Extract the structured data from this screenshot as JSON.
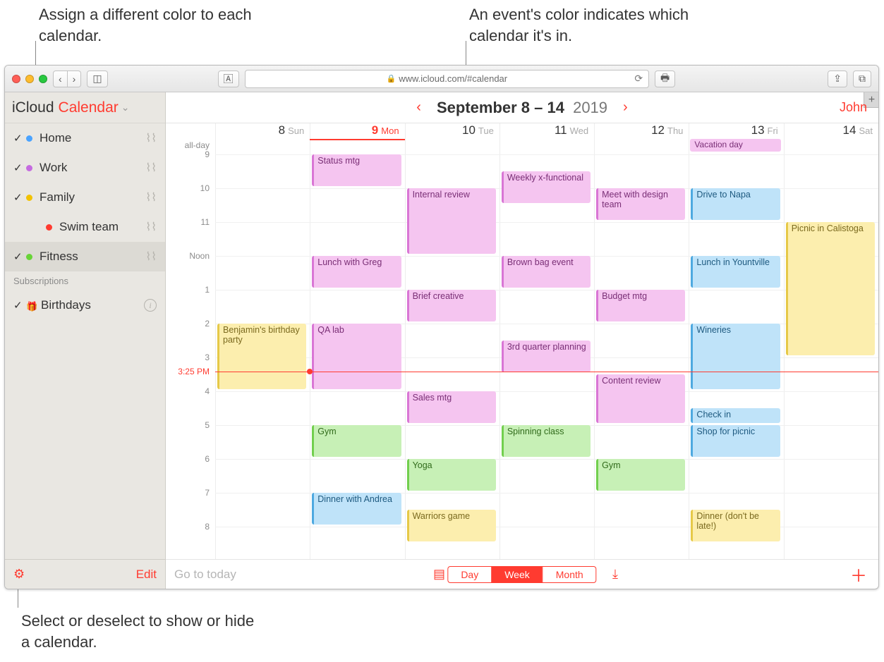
{
  "callouts": {
    "top_left": "Assign a different color to each calendar.",
    "top_right": "An event's color indicates which calendar it's in.",
    "bottom": "Select or deselect to show or hide a calendar."
  },
  "browser": {
    "url": "www.icloud.com/#calendar"
  },
  "sidebar": {
    "app_prefix": "iCloud",
    "app_name": "Calendar",
    "section_subs": "Subscriptions",
    "edit": "Edit",
    "calendars": [
      {
        "name": "Home",
        "color": "#4aa3ff",
        "checked": true,
        "shared": true,
        "indent": false,
        "selected": false
      },
      {
        "name": "Work",
        "color": "#c56be0",
        "checked": true,
        "shared": true,
        "indent": false,
        "selected": false
      },
      {
        "name": "Family",
        "color": "#f2c200",
        "checked": true,
        "shared": true,
        "indent": false,
        "selected": false
      },
      {
        "name": "Swim team",
        "color": "#ff3b30",
        "checked": false,
        "shared": true,
        "indent": true,
        "selected": false
      },
      {
        "name": "Fitness",
        "color": "#68d437",
        "checked": true,
        "shared": true,
        "indent": false,
        "selected": true
      }
    ],
    "subs": [
      {
        "name": "Birthdays",
        "checked": true
      }
    ]
  },
  "header": {
    "range": "September 8 – 14",
    "year": "2019",
    "user": "John"
  },
  "days": [
    {
      "num": "8",
      "name": "Sun",
      "today": false
    },
    {
      "num": "9",
      "name": "Mon",
      "today": true
    },
    {
      "num": "10",
      "name": "Tue",
      "today": false
    },
    {
      "num": "11",
      "name": "Wed",
      "today": false
    },
    {
      "num": "12",
      "name": "Thu",
      "today": false
    },
    {
      "num": "13",
      "name": "Fri",
      "today": false
    },
    {
      "num": "14",
      "name": "Sat",
      "today": false
    }
  ],
  "time": {
    "allday": "all-day",
    "labels": [
      "9",
      "10",
      "11",
      "Noon",
      "1",
      "2",
      "3",
      "4",
      "5",
      "6",
      "7",
      "8"
    ],
    "now": "3:25 PM"
  },
  "allday_events": [
    {
      "day": 5,
      "span": 1,
      "title": "Vacation day",
      "cls": "ev-purple"
    }
  ],
  "events": [
    {
      "day": 0,
      "start": 2.0,
      "dur": 2.0,
      "title": "Benjamin's birthday party",
      "cls": "ev-yellow"
    },
    {
      "day": 1,
      "start": 9.0,
      "dur": 1.0,
      "title": "Status mtg",
      "cls": "ev-purple"
    },
    {
      "day": 1,
      "start": 12.0,
      "dur": 1.0,
      "title": "Lunch with Greg",
      "cls": "ev-purple"
    },
    {
      "day": 1,
      "start": 2.0,
      "dur": 2.0,
      "title": "QA lab",
      "cls": "ev-purple"
    },
    {
      "day": 1,
      "start": 5.0,
      "dur": 1.0,
      "title": "Gym",
      "cls": "ev-green"
    },
    {
      "day": 1,
      "start": 7.0,
      "dur": 1.0,
      "title": "Dinner with Andrea",
      "cls": "ev-blue"
    },
    {
      "day": 2,
      "start": 10.0,
      "dur": 2.0,
      "title": "Internal review",
      "cls": "ev-purple"
    },
    {
      "day": 2,
      "start": 1.0,
      "dur": 1.0,
      "title": "Brief creative",
      "cls": "ev-purple"
    },
    {
      "day": 2,
      "start": 4.0,
      "dur": 1.0,
      "title": "Sales mtg",
      "cls": "ev-purple"
    },
    {
      "day": 2,
      "start": 6.0,
      "dur": 1.0,
      "title": "Yoga",
      "cls": "ev-green"
    },
    {
      "day": 2,
      "start": 7.5,
      "dur": 1.0,
      "title": "Warriors game",
      "cls": "ev-yellow"
    },
    {
      "day": 3,
      "start": 9.5,
      "dur": 1.0,
      "title": "Weekly x-functional",
      "cls": "ev-purple"
    },
    {
      "day": 3,
      "start": 12.0,
      "dur": 1.0,
      "title": "Brown bag event",
      "cls": "ev-purple"
    },
    {
      "day": 3,
      "start": 2.5,
      "dur": 1.0,
      "title": "3rd quarter planning",
      "cls": "ev-purple"
    },
    {
      "day": 3,
      "start": 5.0,
      "dur": 1.0,
      "title": "Spinning class",
      "cls": "ev-green"
    },
    {
      "day": 4,
      "start": 10.0,
      "dur": 1.0,
      "title": "Meet with design team",
      "cls": "ev-purple"
    },
    {
      "day": 4,
      "start": 1.0,
      "dur": 1.0,
      "title": "Budget mtg",
      "cls": "ev-purple"
    },
    {
      "day": 4,
      "start": 3.5,
      "dur": 1.5,
      "title": "Content review",
      "cls": "ev-purple"
    },
    {
      "day": 4,
      "start": 6.0,
      "dur": 1.0,
      "title": "Gym",
      "cls": "ev-green"
    },
    {
      "day": 5,
      "start": 10.0,
      "dur": 1.0,
      "title": "Drive to Napa",
      "cls": "ev-blue"
    },
    {
      "day": 5,
      "start": 12.0,
      "dur": 1.0,
      "title": "Lunch in Yountville",
      "cls": "ev-blue"
    },
    {
      "day": 5,
      "start": 2.0,
      "dur": 2.0,
      "title": "Wineries",
      "cls": "ev-blue"
    },
    {
      "day": 5,
      "start": 4.5,
      "dur": 0.5,
      "title": "Check in",
      "cls": "ev-blue"
    },
    {
      "day": 5,
      "start": 5.0,
      "dur": 1.0,
      "title": "Shop for picnic",
      "cls": "ev-blue"
    },
    {
      "day": 5,
      "start": 7.5,
      "dur": 1.0,
      "title": "Dinner (don't be late!)",
      "cls": "ev-yellow"
    },
    {
      "day": 6,
      "start": 11.0,
      "dur": 4.0,
      "title": "Picnic in Calistoga",
      "cls": "ev-yellow"
    }
  ],
  "footer": {
    "today": "Go to today",
    "views": [
      "Day",
      "Week",
      "Month"
    ],
    "active_view": 1
  }
}
